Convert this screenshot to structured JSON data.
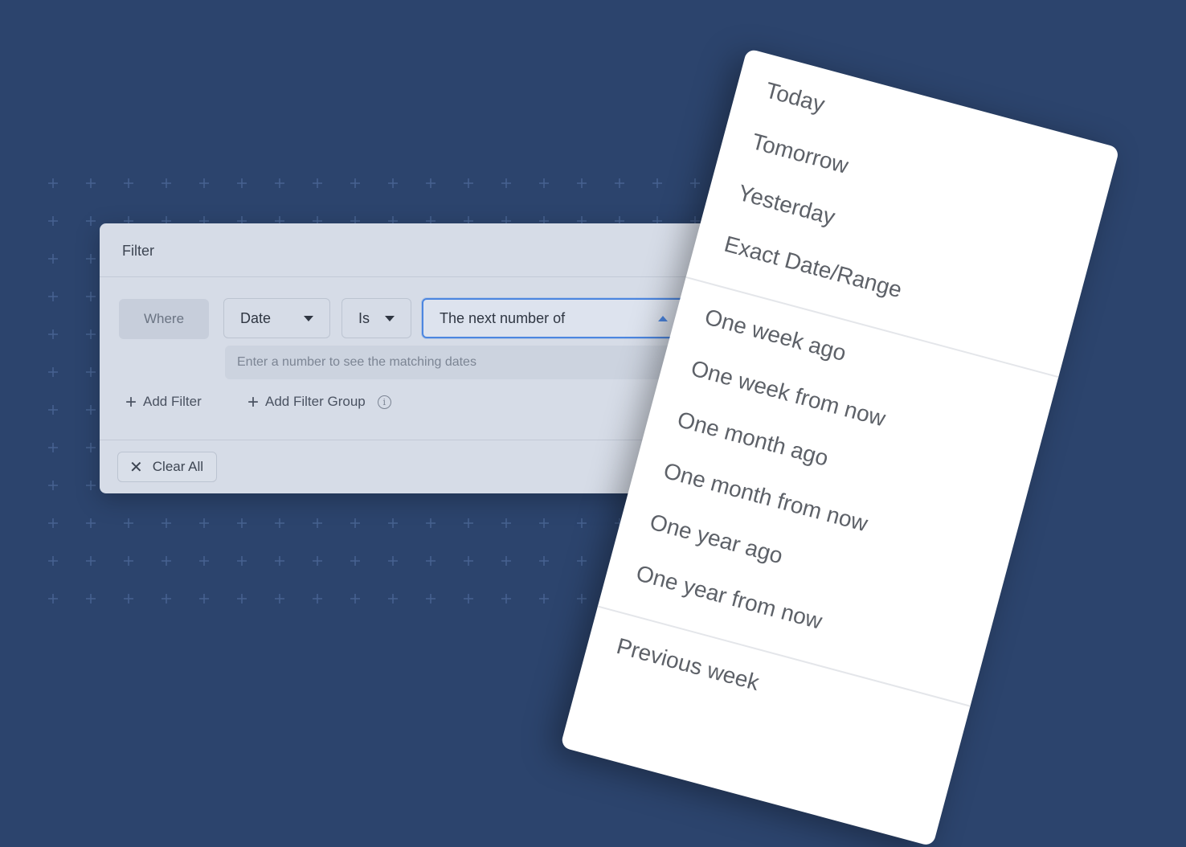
{
  "filter": {
    "title": "Filter",
    "where_label": "Where",
    "field_select": "Date",
    "operator_select": "Is",
    "value_select": "The next number of",
    "hint": "Enter a number to see the matching dates",
    "add_filter": "Add Filter",
    "add_filter_group": "Add Filter Group",
    "clear_all": "Clear All"
  },
  "dropdown": {
    "group1": [
      "Today",
      "Tomorrow",
      "Yesterday",
      "Exact Date/Range"
    ],
    "group2": [
      "One week ago",
      "One week from now",
      "One month ago",
      "One month from now",
      "One year ago",
      "One year from now"
    ],
    "group3": [
      "Previous week"
    ]
  },
  "colors": {
    "background": "#2c446d",
    "accent": "#4c86e0"
  }
}
